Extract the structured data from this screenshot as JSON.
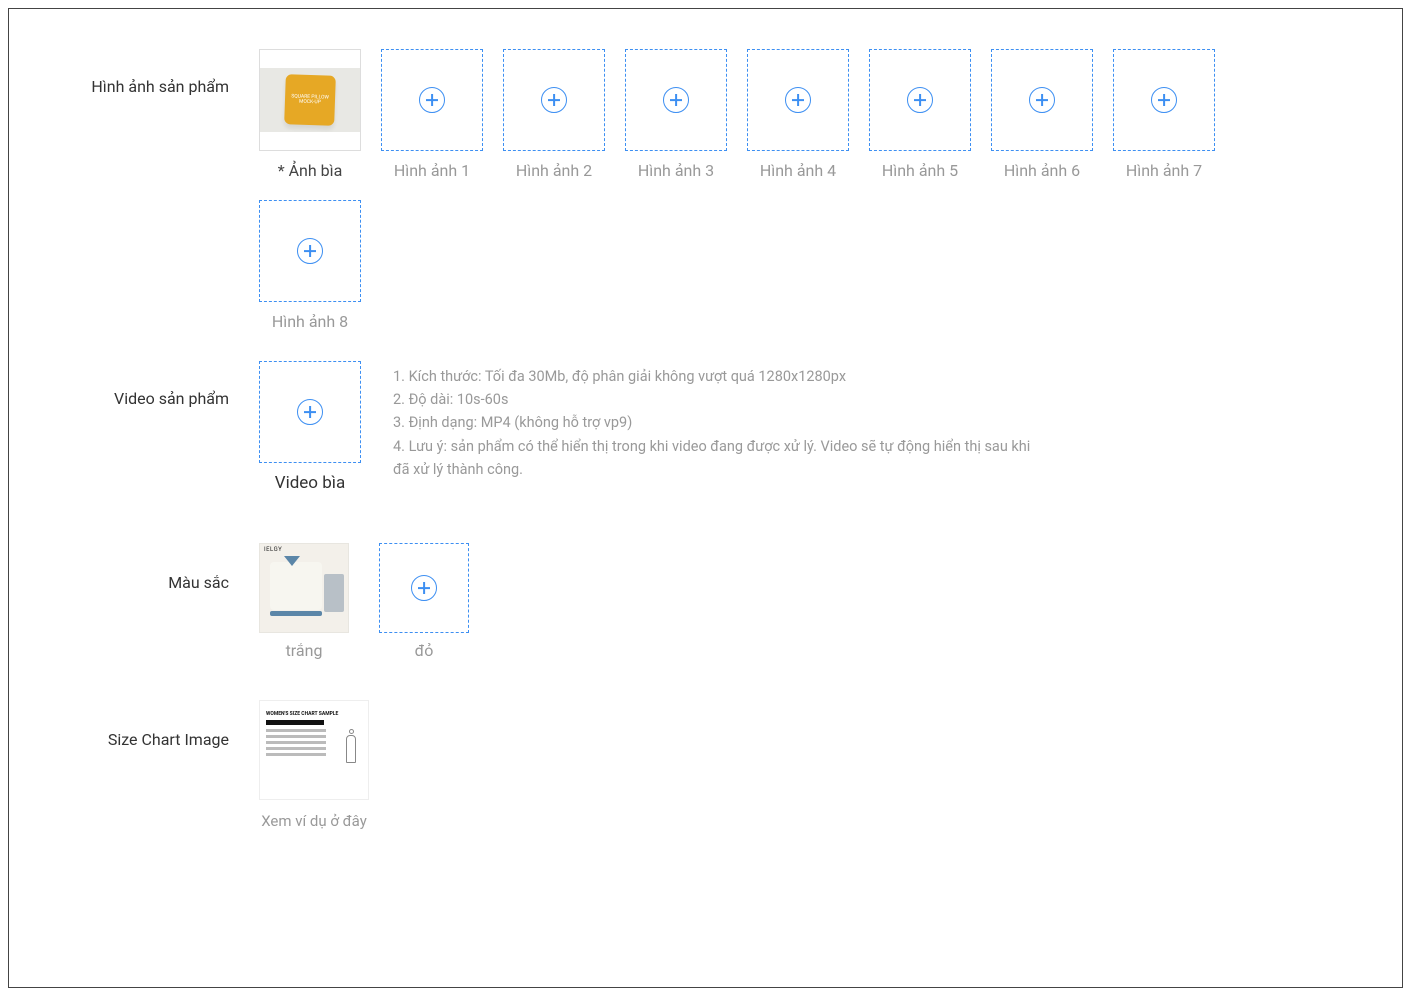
{
  "sections": {
    "productImages": {
      "label": "Hình ảnh sản phẩm",
      "cover": {
        "label": "* Ảnh bìa",
        "mockText": "SQUARE PILLOW MOCK-UP"
      },
      "slots": [
        {
          "label": "Hình ảnh 1"
        },
        {
          "label": "Hình ảnh 2"
        },
        {
          "label": "Hình ảnh 3"
        },
        {
          "label": "Hình ảnh 4"
        },
        {
          "label": "Hình ảnh 5"
        },
        {
          "label": "Hình ảnh 6"
        },
        {
          "label": "Hình ảnh 7"
        },
        {
          "label": "Hình ảnh 8"
        }
      ]
    },
    "productVideo": {
      "label": "Video sản phẩm",
      "slot": {
        "label": "Video bìa"
      },
      "hints": [
        "Kích thước: Tối đa 30Mb, độ phân giải không vượt quá 1280x1280px",
        "Độ dài: 10s-60s",
        "Định dạng: MP4 (không hỗ trợ vp9)",
        "Lưu ý: sản phẩm có thể hiển thị trong khi video đang được xử lý. Video sẽ tự động hiển thị sau khi đã xử lý thành công."
      ]
    },
    "color": {
      "label": "Màu sắc",
      "items": [
        {
          "label": "trắng",
          "brand": "IELGY"
        },
        {
          "label": "đỏ"
        }
      ]
    },
    "sizeChart": {
      "label": "Size Chart Image",
      "exampleLabel": "Xem ví dụ ở đây",
      "thumbTitle": "WOMEN'S SIZE CHART SAMPLE"
    }
  }
}
